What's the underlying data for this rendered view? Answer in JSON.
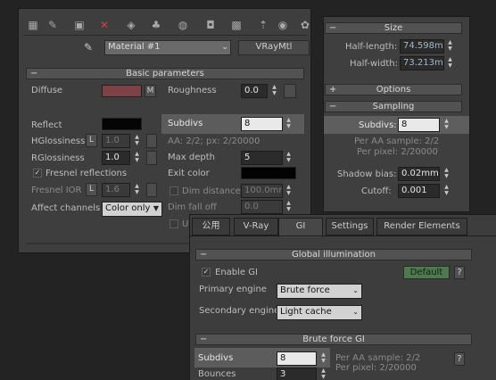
{
  "toolbar": {
    "icons": [
      "select-by-material-icon",
      "pick-material-icon",
      "put-to-scene-icon",
      "delete-material-icon",
      "put-to-library-icon",
      "material-id-icon",
      "show-map-icon",
      "show-end-result-icon",
      "background-icon",
      "go-to-parent-icon",
      "go-forward-icon",
      "options-icon"
    ],
    "material_name": "Material #1",
    "material_type": "VRayMtl"
  },
  "basic": {
    "title": "Basic parameters",
    "diffuse_label": "Diffuse",
    "diffuse_color": "#7d4246",
    "map_m": "M",
    "roughness_label": "Roughness",
    "roughness_value": "0.0",
    "reflect_label": "Reflect",
    "reflect_color": "#050505",
    "hglossiness_label": "HGlossiness",
    "hglossiness_lock": "L",
    "hglossiness_value": "1.0",
    "rglossiness_label": "RGlossiness",
    "rglossiness_value": "1.0",
    "fresnel_label": "Fresnel reflections",
    "fresnel_ior_label": "Fresnel IOR",
    "fresnel_ior_lock": "L",
    "fresnel_ior_value": "1.6",
    "affect_channels_label": "Affect channels",
    "affect_channels_value": "Color only",
    "subdivs_label": "Subdivs",
    "subdivs_value": "8",
    "aa_text": "AA: 2/2; px: 2/20000",
    "max_depth_label": "Max depth",
    "max_depth_value": "5",
    "exit_color_label": "Exit color",
    "exit_color": "#030303",
    "dim_distance_label": "Dim distance",
    "dim_distance_value": "100.0mm",
    "dim_falloff_label": "Dim fall off",
    "dim_falloff_value": "0.0",
    "cut_label": "U"
  },
  "light": {
    "size_title": "Size",
    "half_length_label": "Half-length:",
    "half_length_value": "74.598mm",
    "half_width_label": "Half-width:",
    "half_width_value": "73.213mm",
    "options_title": "Options",
    "sampling_title": "Sampling",
    "subdivs_label": "Subdivs:",
    "subdivs_value": "8",
    "per_aa": "Per AA sample: 2/2",
    "per_pixel": "Per pixel: 2/20000",
    "shadow_bias_label": "Shadow bias:",
    "shadow_bias_value": "0.02mm",
    "cutoff_label": "Cutoff:",
    "cutoff_value": "0.001"
  },
  "render": {
    "tabs": [
      "公用",
      "V-Ray",
      "GI",
      "Settings",
      "Render Elements"
    ],
    "gi_title": "Global illumination",
    "enable_gi_label": "Enable GI",
    "default_label": "Default",
    "help": "?",
    "primary_label": "Primary engine",
    "primary_value": "Brute force",
    "secondary_label": "Secondary engine",
    "secondary_value": "Light cache",
    "bf_title": "Brute force GI",
    "subdivs_label": "Subdivs",
    "subdivs_value": "8",
    "bounces_label": "Bounces",
    "bounces_value": "3",
    "per_aa": "Per AA sample: 2/2",
    "per_pixel": "Per pixel: 2/20000"
  }
}
